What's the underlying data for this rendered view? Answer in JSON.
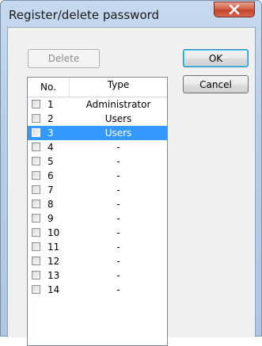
{
  "window": {
    "title": "Register/delete password"
  },
  "buttons": {
    "delete_label": "Delete",
    "ok_label": "OK",
    "cancel_label": "Cancel"
  },
  "list": {
    "columns": [
      "No.",
      "Type"
    ],
    "rows": [
      {
        "no": "1",
        "type": "Administrator",
        "selected": false
      },
      {
        "no": "2",
        "type": "Users",
        "selected": false
      },
      {
        "no": "3",
        "type": "Users",
        "selected": true
      },
      {
        "no": "4",
        "type": "-",
        "selected": false
      },
      {
        "no": "5",
        "type": "-",
        "selected": false
      },
      {
        "no": "6",
        "type": "-",
        "selected": false
      },
      {
        "no": "7",
        "type": "-",
        "selected": false
      },
      {
        "no": "8",
        "type": "-",
        "selected": false
      },
      {
        "no": "9",
        "type": "-",
        "selected": false
      },
      {
        "no": "10",
        "type": "-",
        "selected": false
      },
      {
        "no": "11",
        "type": "-",
        "selected": false
      },
      {
        "no": "12",
        "type": "-",
        "selected": false
      },
      {
        "no": "13",
        "type": "-",
        "selected": false
      },
      {
        "no": "14",
        "type": "-",
        "selected": false
      }
    ]
  },
  "colors": {
    "selection": "#3399ff",
    "close_button": "#c2412a",
    "frame": "#b7cde7"
  },
  "icons": {
    "close": "close-icon",
    "checkbox": "checkbox"
  }
}
